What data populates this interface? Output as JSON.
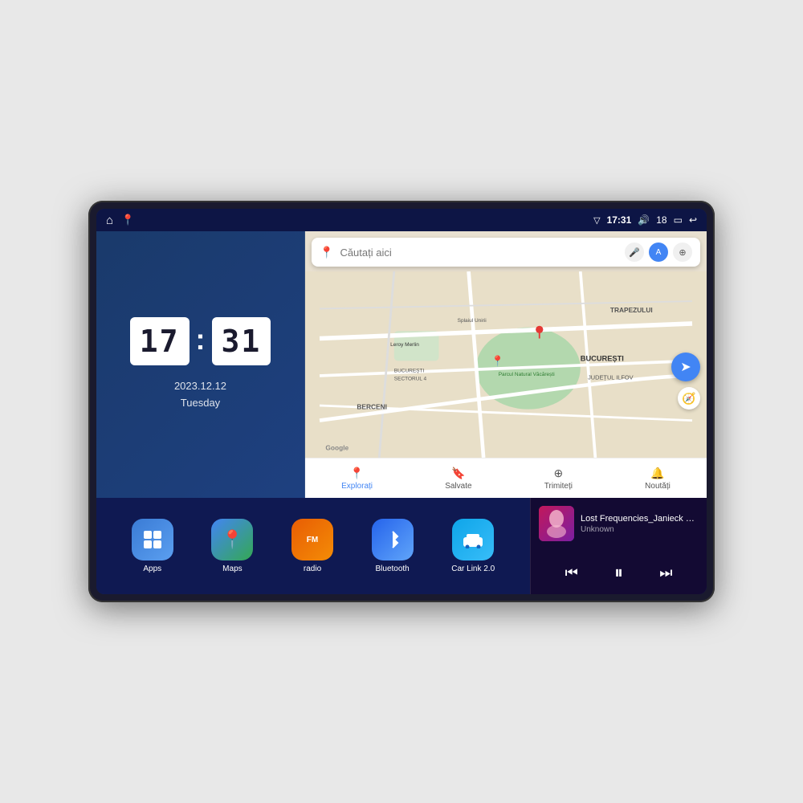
{
  "device": {
    "screen_bg": "#1a237e"
  },
  "status_bar": {
    "nav_home": "⌂",
    "nav_map": "📍",
    "signal_icon": "▽",
    "time": "17:31",
    "volume_icon": "🔊",
    "volume_level": "18",
    "battery_icon": "▭",
    "back_icon": "↩"
  },
  "clock": {
    "hours": "17",
    "minutes": "31",
    "date": "2023.12.12",
    "day": "Tuesday"
  },
  "map": {
    "search_placeholder": "Căutați aici",
    "tabs": [
      {
        "id": "explorari",
        "label": "Explorați",
        "icon": "📍",
        "active": true
      },
      {
        "id": "salvate",
        "label": "Salvate",
        "icon": "🔖",
        "active": false
      },
      {
        "id": "trimiteti",
        "label": "Trimiteți",
        "icon": "⊕",
        "active": false
      },
      {
        "id": "noutati",
        "label": "Noutăți",
        "icon": "🔔",
        "active": false
      }
    ],
    "labels": [
      {
        "text": "TRAPEZULUI",
        "type": "bold"
      },
      {
        "text": "BUCUREȘTI",
        "type": "bold"
      },
      {
        "text": "JUDEȚUL ILFOV",
        "type": "bold"
      },
      {
        "text": "Parcul Natural Văcărești",
        "type": "normal"
      },
      {
        "text": "Leroy Merlin",
        "type": "normal"
      },
      {
        "text": "BUCUREȘTI SECTORUL 4",
        "type": "normal"
      },
      {
        "text": "BERCENI",
        "type": "normal"
      },
      {
        "text": "Splaiul Unirii",
        "type": "normal"
      }
    ],
    "google_logo": "Google"
  },
  "apps": [
    {
      "id": "apps",
      "label": "Apps",
      "icon": "⊞",
      "color_class": "icon-apps"
    },
    {
      "id": "maps",
      "label": "Maps",
      "icon": "🗺",
      "color_class": "icon-maps"
    },
    {
      "id": "radio",
      "label": "radio",
      "icon": "📻",
      "color_class": "icon-radio"
    },
    {
      "id": "bluetooth",
      "label": "Bluetooth",
      "icon": "◈",
      "color_class": "icon-bluetooth"
    },
    {
      "id": "carlink",
      "label": "Car Link 2.0",
      "icon": "🚗",
      "color_class": "icon-carlink"
    }
  ],
  "music_player": {
    "title": "Lost Frequencies_Janieck Devy-...",
    "artist": "Unknown",
    "prev_icon": "⏮",
    "play_icon": "⏸",
    "next_icon": "⏭"
  }
}
